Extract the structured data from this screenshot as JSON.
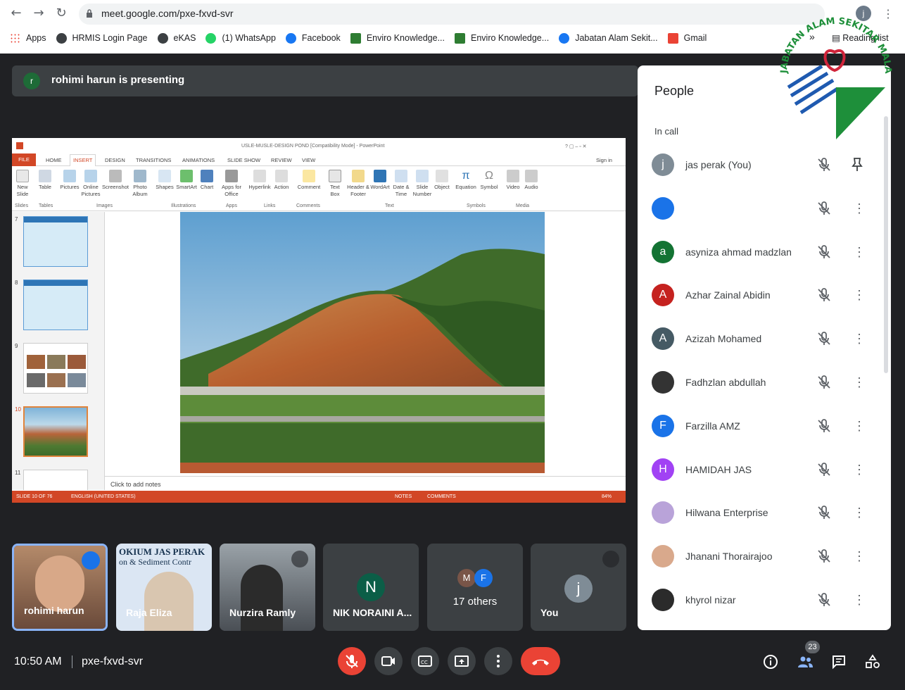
{
  "browser": {
    "url": "meet.google.com/pxe-fxvd-svr",
    "avatar_letter": "j",
    "bookmarks": [
      "Apps",
      "HRMIS Login Page",
      "eKAS",
      "(1) WhatsApp",
      "Facebook",
      "Enviro Knowledge...",
      "Enviro Knowledge...",
      "Jabatan Alam Sekit...",
      "Gmail"
    ],
    "overflow": "»",
    "reading_list": "Reading list"
  },
  "presenting": {
    "avatar_letter": "r",
    "text": "rohimi harun is presenting"
  },
  "ppt": {
    "window_title": "USLE-MUSLE-DESIGN POND [Compatibility Mode] - PowerPoint",
    "sign_in": "Sign in",
    "tabs": [
      "FILE",
      "HOME",
      "INSERT",
      "DESIGN",
      "TRANSITIONS",
      "ANIMATIONS",
      "SLIDE SHOW",
      "REVIEW",
      "VIEW"
    ],
    "ribbon_buttons": [
      "New Slide",
      "Table",
      "Pictures",
      "Online Pictures",
      "Screenshot",
      "Photo Album",
      "Shapes",
      "SmartArt",
      "Chart",
      "Apps for Office",
      "Hyperlink",
      "Action",
      "Comment",
      "Text Box",
      "Header & Footer",
      "WordArt",
      "Date & Time",
      "Slide Number",
      "Object",
      "Equation",
      "Symbol",
      "Video",
      "Audio"
    ],
    "ribbon_groups": [
      "Slides",
      "Tables",
      "Images",
      "Illustrations",
      "Apps",
      "Links",
      "Comments",
      "Text",
      "Symbols",
      "Media"
    ],
    "thumb_numbers": [
      "7",
      "8",
      "9",
      "10",
      "11"
    ],
    "notes_placeholder": "Click to add notes",
    "status_slide": "SLIDE 10 OF 76",
    "status_lang": "ENGLISH (UNITED STATES)",
    "status_notes": "NOTES",
    "status_comments": "COMMENTS",
    "zoom": "84%"
  },
  "tiles": [
    {
      "name": "rohimi harun",
      "speaking": true
    },
    {
      "name": "Raja Eliza",
      "caption1": "OKIUM JAS PERAK",
      "caption2": "on & Sediment Contr"
    },
    {
      "name": "Nurzira Ramly"
    },
    {
      "name": "NIK NORAINI A...",
      "letter": "N",
      "color": "#0b5e47"
    },
    {
      "name": "17 others",
      "letters": [
        "M",
        "F"
      ]
    },
    {
      "name": "You",
      "letter": "j",
      "color": "#7f8c96"
    }
  ],
  "people": {
    "title": "People",
    "section": "In call",
    "rows": [
      {
        "name": "jas perak (You)",
        "letter": "j",
        "color": "#7f8c96"
      },
      {
        "name": "",
        "letter": "",
        "color": "#1a73e8"
      },
      {
        "name": "asyniza ahmad madzlan",
        "letter": "a",
        "color": "#137333"
      },
      {
        "name": "Azhar Zainal Abidin",
        "letter": "A",
        "color": "#c5221f"
      },
      {
        "name": "Azizah Mohamed",
        "letter": "A",
        "color": "#455a64"
      },
      {
        "name": "Fadhzlan abdullah",
        "letter": "",
        "color": "#333333"
      },
      {
        "name": "Farzilla AMZ",
        "letter": "F",
        "color": "#1a73e8"
      },
      {
        "name": "HAMIDAH JAS",
        "letter": "H",
        "color": "#a142f4"
      },
      {
        "name": "Hilwana Enterprise",
        "letter": "",
        "color": "#b9a3d9"
      },
      {
        "name": "Jhanani Thorairajoo",
        "letter": "",
        "color": "#d9a98c"
      },
      {
        "name": "khyrol nizar",
        "letter": "",
        "color": "#2b2b2b"
      }
    ]
  },
  "bottom": {
    "time": "10:50 AM",
    "separator": "|",
    "meeting_code": "pxe-fxvd-svr",
    "participant_count": "23"
  },
  "logo": {
    "text": "JABATAN ALAM SEKITAR MALAYSIA"
  },
  "colors": {
    "accent": "#8ab4f8",
    "danger": "#ea4335",
    "ppt": "#d24726"
  }
}
